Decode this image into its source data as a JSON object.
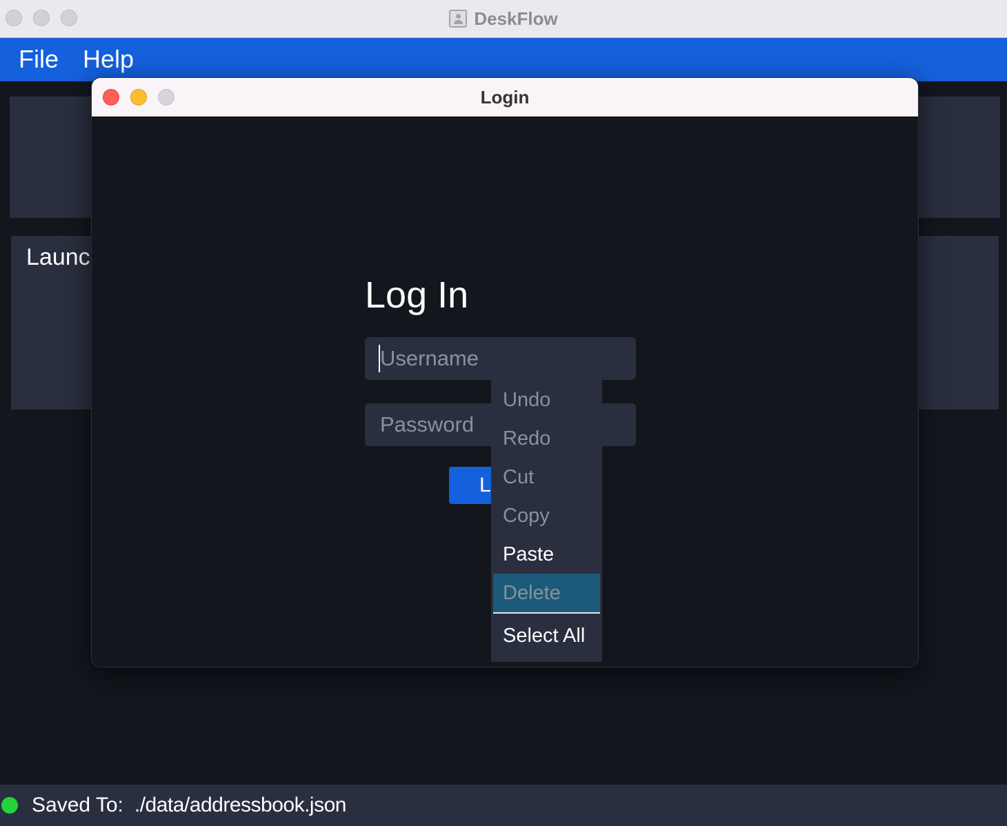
{
  "app": {
    "title": "DeskFlow",
    "icon": "app-contact-icon"
  },
  "menubar": {
    "file": "File",
    "help": "Help"
  },
  "panels": {
    "launch_title": "Launch"
  },
  "status": {
    "label": "Saved To:",
    "path": "./data/addressbook.json",
    "indicator_color": "#22d33a"
  },
  "dialog": {
    "title": "Login",
    "heading": "Log In",
    "username_placeholder": "Username",
    "password_placeholder": "Password",
    "login_button": "Login"
  },
  "context_menu": {
    "undo": "Undo",
    "redo": "Redo",
    "cut": "Cut",
    "copy": "Copy",
    "paste": "Paste",
    "delete": "Delete",
    "select_all": "Select All"
  },
  "colors": {
    "accent": "#1560dd",
    "panel": "#2a2f3f",
    "background": "#13161d",
    "highlight": "#1b5a7a"
  }
}
